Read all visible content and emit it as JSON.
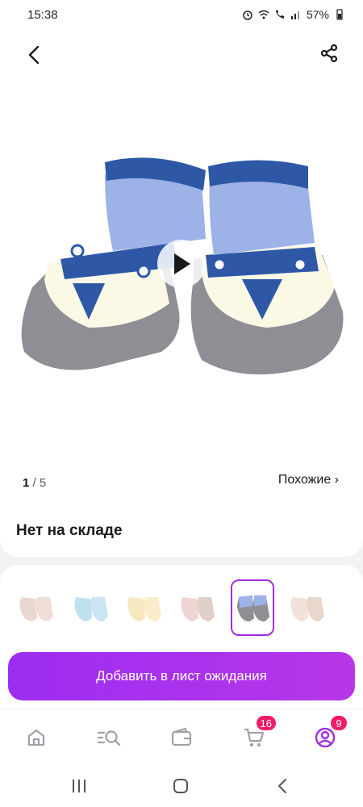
{
  "status": {
    "time": "15:38",
    "battery": "57%"
  },
  "product": {
    "image_counter_current": "1",
    "image_counter_total": "/ 5",
    "similar_link": "Похожие ›",
    "stock_status": "Нет на складе"
  },
  "cta": {
    "label": "Добавить в лист ожидания"
  },
  "bottom_nav": {
    "items": [
      {
        "icon": "home-icon"
      },
      {
        "icon": "search-catalog-icon"
      },
      {
        "icon": "wallet-icon"
      },
      {
        "icon": "cart-icon",
        "badge": "16"
      },
      {
        "icon": "profile-icon",
        "badge": "9"
      }
    ]
  },
  "colors": {
    "accent": "#a12de0",
    "badge": "#f21b6a"
  }
}
